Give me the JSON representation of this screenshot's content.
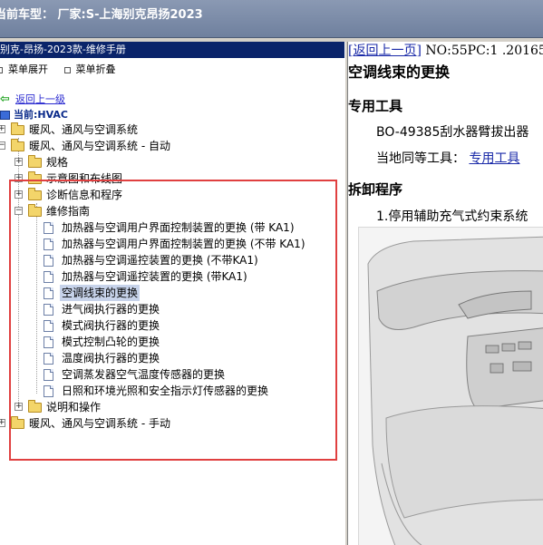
{
  "window": {
    "title": "当前车型：  厂家:S-上海别克昂扬2023"
  },
  "left_panel": {
    "header": "别克-昂扬-2023款-维修手册",
    "menu": {
      "expand": "菜单展开",
      "collapse": "菜单折叠"
    },
    "back_link": "返回上一级",
    "current": "当前:HVAC",
    "tree": [
      {
        "label": "暖风、通风与空调系统"
      },
      {
        "label": "暖风、通风与空调系统 - 自动"
      },
      {
        "label": "规格"
      },
      {
        "label": "示意图和布线图"
      },
      {
        "label": "诊断信息和程序"
      },
      {
        "label": "维修指南"
      },
      {
        "label": "加热器与空调用户界面控制装置的更换 (带 KA1)"
      },
      {
        "label": "加热器与空调用户界面控制装置的更换 (不带 KA1)"
      },
      {
        "label": "加热器与空调遥控装置的更换 (不带KA1)"
      },
      {
        "label": "加热器与空调遥控装置的更换 (带KA1)"
      },
      {
        "label": "空调线束的更换"
      },
      {
        "label": "进气阀执行器的更换"
      },
      {
        "label": "模式阀执行器的更换"
      },
      {
        "label": "模式控制凸轮的更换"
      },
      {
        "label": "温度阀执行器的更换"
      },
      {
        "label": "空调蒸发器空气温度传感器的更换"
      },
      {
        "label": "日照和环境光照和安全指示灯传感器的更换"
      },
      {
        "label": "说明和操作"
      },
      {
        "label": "暖风、通风与空调系统 - 手动"
      }
    ]
  },
  "right_panel": {
    "nav_link": "返回上一页",
    "doc_no": "NO:55PC:1 .20165",
    "title": "空调线束的更换",
    "special_tools_heading": "专用工具",
    "tool_1": "BO-49385刮水器臂拔出器",
    "local_equiv_label": "当地同等工具：",
    "local_equiv_link": "专用工具",
    "removal_heading": "拆卸程序",
    "step_1": "1.停用辅助充气式约束系统"
  }
}
